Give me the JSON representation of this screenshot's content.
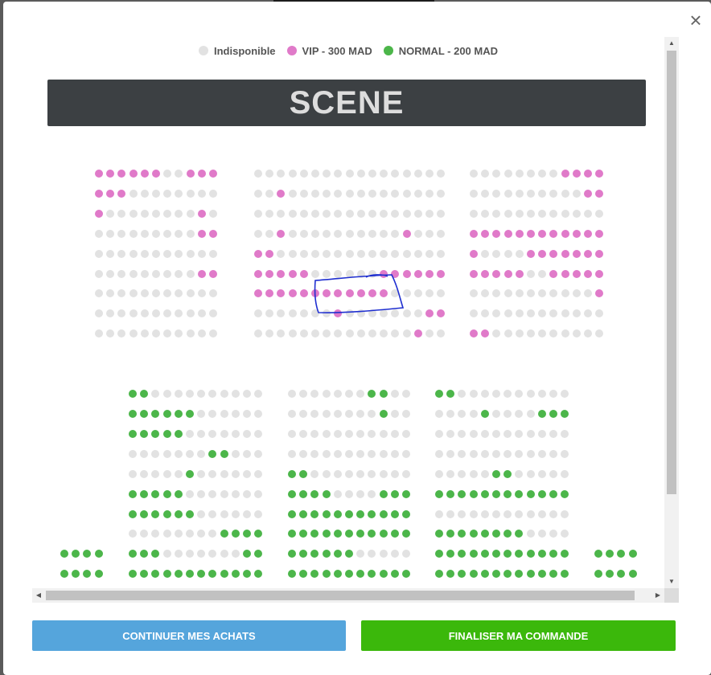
{
  "legend": {
    "items": [
      {
        "label": "Indisponible",
        "color": "#e2e2e2"
      },
      {
        "label": "VIP - 300 MAD",
        "color": "#e07ac9"
      },
      {
        "label": "NORMAL - 200 MAD",
        "color": "#4cb64a"
      }
    ]
  },
  "stage": {
    "label": "SCENE"
  },
  "close": {
    "glyph": "×"
  },
  "seat_colors": {
    "unavailable": "#e2e2e2",
    "vip": "#e07ac9",
    "normal": "#4cb64a"
  },
  "seating": {
    "legend_key": "U = Indisponible, V = VIP - 300 MAD, N = NORMAL - 200 MAD",
    "vip_blocks": [
      {
        "name": "vip-left",
        "rows": [
          "VVVVVVUUVVV",
          "VVVUUUUUUUU",
          "VUUUUUUUUVU",
          "UUUUUUUUUVV",
          "UUUUUUUUUUU",
          "UUUUUUUUUVV",
          "UUUUUUUUUUU",
          "UUUUUUUUUUU",
          "UUUUUUUUUUU"
        ]
      },
      {
        "name": "vip-center",
        "rows": [
          "UUUUUUUUUUUUUUUUU",
          "UUVUUUUUUUUUUUUUU",
          "UUUUUUUUUUUUUUUUU",
          "UUVUUUUUUUUUUVUUU",
          "VVUUUUUUUUUUUUUUU",
          "VVVVVUUUUUUVVVVVV",
          "VVVVVVVVVVVVUUUUU",
          "UUUUUUUVUUUUUUUVV",
          "UUUUUUUUUUUUUUVUU"
        ]
      },
      {
        "name": "vip-right",
        "rows": [
          "UUUUUUUUVVVV",
          "UUUUUUUUUUVV",
          "UUUUUUUUUUUU",
          "VVVVVVVVVVVV",
          "VUUUUVVVVVVV",
          "VVVVVUUVVVVV",
          "UUUUUUUUUUUV",
          "UUUUUUUUUUUU",
          "VVUUUUUUUUUU"
        ]
      }
    ],
    "normal_blocks": [
      {
        "name": "normal-far-left",
        "rows": [
          "",
          "",
          "",
          "",
          "",
          "",
          "",
          "",
          "NNNN",
          "NNNN"
        ]
      },
      {
        "name": "normal-left",
        "rows": [
          "NNUUUUUUUUUU",
          "NNNNNNUUUUUU",
          "NNNNNUUUUUUU",
          "UUUUUUUNNUUU",
          "UUUUUNUUUUUU",
          "NNNNNUUUUUUU",
          "NNNNNNUUUUUU",
          "UUUUUUUUNNNN",
          "NNNUUUUUUUNN",
          "NNNNNNNNNNNN"
        ]
      },
      {
        "name": "normal-center",
        "rows": [
          "UUUUUUUNNUU",
          "UUUUUUUUNUU",
          "UUUUUUUUUUU",
          "UUUUUUUUUUU",
          "NNUUUUUUUUU",
          "NNNNUUUUNNN",
          "NNNNNNNNNNN",
          "NNNNNNNNNNN",
          "NNNNNNUUUUU",
          "NNNNNNNNNNN"
        ]
      },
      {
        "name": "normal-right",
        "rows": [
          "NNUUUUUUUUUU",
          "UUUUNUUUUNNN",
          "UUUUUUUUUUUU",
          "UUUUUUUUUUUU",
          "UUUUUNNUUUUU",
          "NNNNNNNNNNNN",
          "UUUUUUUUUUUU",
          "NNNNNNNNUUUU",
          "NNNNNNNNNNNN",
          "NNNNNNNNNNNN"
        ]
      },
      {
        "name": "normal-far-right",
        "rows": [
          "",
          "",
          "",
          "",
          "",
          "",
          "",
          "",
          "NNNN",
          "NNNN"
        ]
      }
    ]
  },
  "actions": {
    "continue_label": "CONTINUER MES ACHATS",
    "checkout_label": "FINALISER MA COMMANDE"
  }
}
